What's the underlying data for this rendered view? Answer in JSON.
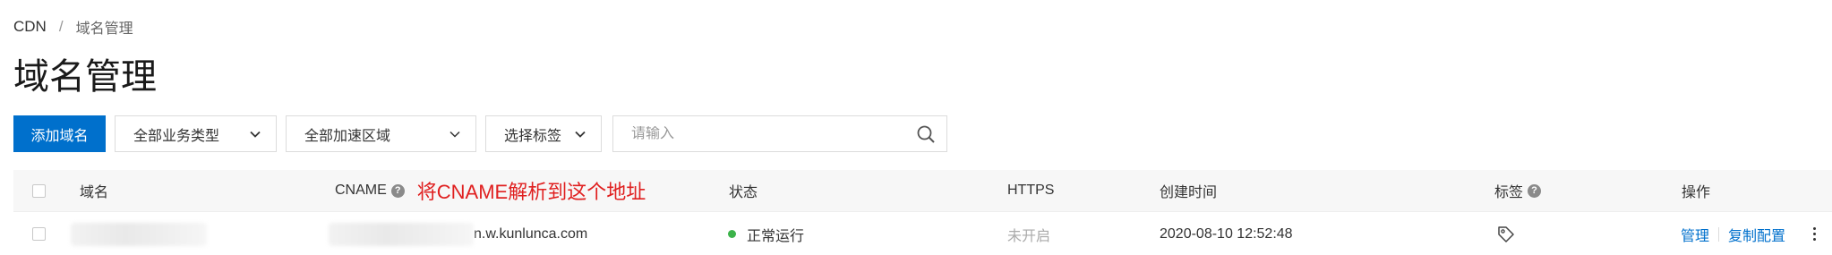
{
  "breadcrumb": {
    "root": "CDN",
    "separator": "/",
    "current": "域名管理"
  },
  "page_title": "域名管理",
  "toolbar": {
    "add_button": "添加域名",
    "business_type": "全部业务类型",
    "region": "全部加速区域",
    "tag_select": "选择标签",
    "search_placeholder": "请输入"
  },
  "table": {
    "headers": {
      "domain": "域名",
      "cname": "CNAME",
      "annotation": "将CNAME解析到这个地址",
      "status": "状态",
      "https": "HTTPS",
      "created": "创建时间",
      "tags": "标签",
      "actions": "操作"
    },
    "rows": [
      {
        "cname_suffix": "n.w.kunlunca.com",
        "status": "正常运行",
        "https": "未开启",
        "created": "2020-08-10 12:52:48",
        "manage": "管理",
        "copy_config": "复制配置"
      }
    ]
  },
  "colors": {
    "primary": "#0070cc",
    "annotation": "#e02020",
    "status_ok": "#3cb34a"
  },
  "icons": {
    "search": "search-icon",
    "help": "help-icon",
    "tag": "tag-icon",
    "more": "more-vertical-icon",
    "chevron": "chevron-down-icon"
  }
}
